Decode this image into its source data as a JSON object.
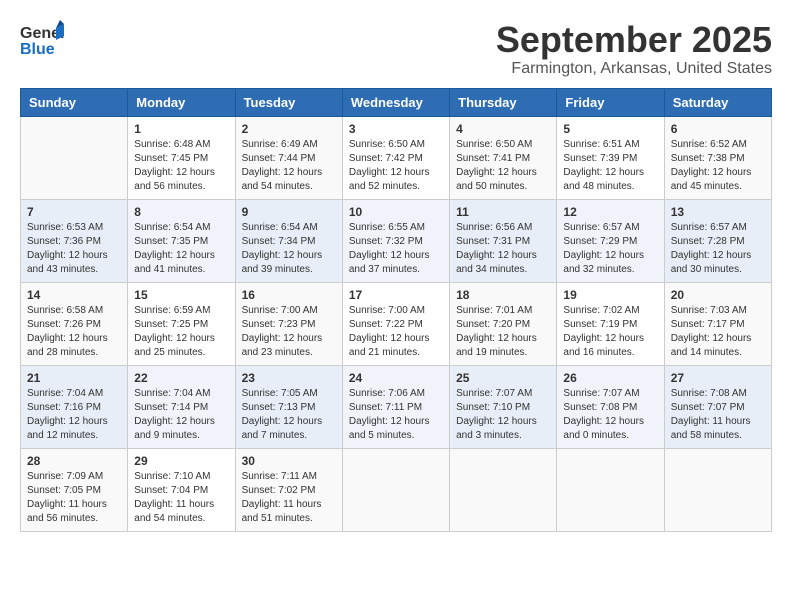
{
  "header": {
    "logo_general": "General",
    "logo_blue": "Blue",
    "title": "September 2025",
    "subtitle": "Farmington, Arkansas, United States"
  },
  "weekdays": [
    "Sunday",
    "Monday",
    "Tuesday",
    "Wednesday",
    "Thursday",
    "Friday",
    "Saturday"
  ],
  "weeks": [
    [
      {
        "day": "",
        "info": ""
      },
      {
        "day": "1",
        "info": "Sunrise: 6:48 AM\nSunset: 7:45 PM\nDaylight: 12 hours\nand 56 minutes."
      },
      {
        "day": "2",
        "info": "Sunrise: 6:49 AM\nSunset: 7:44 PM\nDaylight: 12 hours\nand 54 minutes."
      },
      {
        "day": "3",
        "info": "Sunrise: 6:50 AM\nSunset: 7:42 PM\nDaylight: 12 hours\nand 52 minutes."
      },
      {
        "day": "4",
        "info": "Sunrise: 6:50 AM\nSunset: 7:41 PM\nDaylight: 12 hours\nand 50 minutes."
      },
      {
        "day": "5",
        "info": "Sunrise: 6:51 AM\nSunset: 7:39 PM\nDaylight: 12 hours\nand 48 minutes."
      },
      {
        "day": "6",
        "info": "Sunrise: 6:52 AM\nSunset: 7:38 PM\nDaylight: 12 hours\nand 45 minutes."
      }
    ],
    [
      {
        "day": "7",
        "info": "Sunrise: 6:53 AM\nSunset: 7:36 PM\nDaylight: 12 hours\nand 43 minutes."
      },
      {
        "day": "8",
        "info": "Sunrise: 6:54 AM\nSunset: 7:35 PM\nDaylight: 12 hours\nand 41 minutes."
      },
      {
        "day": "9",
        "info": "Sunrise: 6:54 AM\nSunset: 7:34 PM\nDaylight: 12 hours\nand 39 minutes."
      },
      {
        "day": "10",
        "info": "Sunrise: 6:55 AM\nSunset: 7:32 PM\nDaylight: 12 hours\nand 37 minutes."
      },
      {
        "day": "11",
        "info": "Sunrise: 6:56 AM\nSunset: 7:31 PM\nDaylight: 12 hours\nand 34 minutes."
      },
      {
        "day": "12",
        "info": "Sunrise: 6:57 AM\nSunset: 7:29 PM\nDaylight: 12 hours\nand 32 minutes."
      },
      {
        "day": "13",
        "info": "Sunrise: 6:57 AM\nSunset: 7:28 PM\nDaylight: 12 hours\nand 30 minutes."
      }
    ],
    [
      {
        "day": "14",
        "info": "Sunrise: 6:58 AM\nSunset: 7:26 PM\nDaylight: 12 hours\nand 28 minutes."
      },
      {
        "day": "15",
        "info": "Sunrise: 6:59 AM\nSunset: 7:25 PM\nDaylight: 12 hours\nand 25 minutes."
      },
      {
        "day": "16",
        "info": "Sunrise: 7:00 AM\nSunset: 7:23 PM\nDaylight: 12 hours\nand 23 minutes."
      },
      {
        "day": "17",
        "info": "Sunrise: 7:00 AM\nSunset: 7:22 PM\nDaylight: 12 hours\nand 21 minutes."
      },
      {
        "day": "18",
        "info": "Sunrise: 7:01 AM\nSunset: 7:20 PM\nDaylight: 12 hours\nand 19 minutes."
      },
      {
        "day": "19",
        "info": "Sunrise: 7:02 AM\nSunset: 7:19 PM\nDaylight: 12 hours\nand 16 minutes."
      },
      {
        "day": "20",
        "info": "Sunrise: 7:03 AM\nSunset: 7:17 PM\nDaylight: 12 hours\nand 14 minutes."
      }
    ],
    [
      {
        "day": "21",
        "info": "Sunrise: 7:04 AM\nSunset: 7:16 PM\nDaylight: 12 hours\nand 12 minutes."
      },
      {
        "day": "22",
        "info": "Sunrise: 7:04 AM\nSunset: 7:14 PM\nDaylight: 12 hours\nand 9 minutes."
      },
      {
        "day": "23",
        "info": "Sunrise: 7:05 AM\nSunset: 7:13 PM\nDaylight: 12 hours\nand 7 minutes."
      },
      {
        "day": "24",
        "info": "Sunrise: 7:06 AM\nSunset: 7:11 PM\nDaylight: 12 hours\nand 5 minutes."
      },
      {
        "day": "25",
        "info": "Sunrise: 7:07 AM\nSunset: 7:10 PM\nDaylight: 12 hours\nand 3 minutes."
      },
      {
        "day": "26",
        "info": "Sunrise: 7:07 AM\nSunset: 7:08 PM\nDaylight: 12 hours\nand 0 minutes."
      },
      {
        "day": "27",
        "info": "Sunrise: 7:08 AM\nSunset: 7:07 PM\nDaylight: 11 hours\nand 58 minutes."
      }
    ],
    [
      {
        "day": "28",
        "info": "Sunrise: 7:09 AM\nSunset: 7:05 PM\nDaylight: 11 hours\nand 56 minutes."
      },
      {
        "day": "29",
        "info": "Sunrise: 7:10 AM\nSunset: 7:04 PM\nDaylight: 11 hours\nand 54 minutes."
      },
      {
        "day": "30",
        "info": "Sunrise: 7:11 AM\nSunset: 7:02 PM\nDaylight: 11 hours\nand 51 minutes."
      },
      {
        "day": "",
        "info": ""
      },
      {
        "day": "",
        "info": ""
      },
      {
        "day": "",
        "info": ""
      },
      {
        "day": "",
        "info": ""
      }
    ]
  ]
}
